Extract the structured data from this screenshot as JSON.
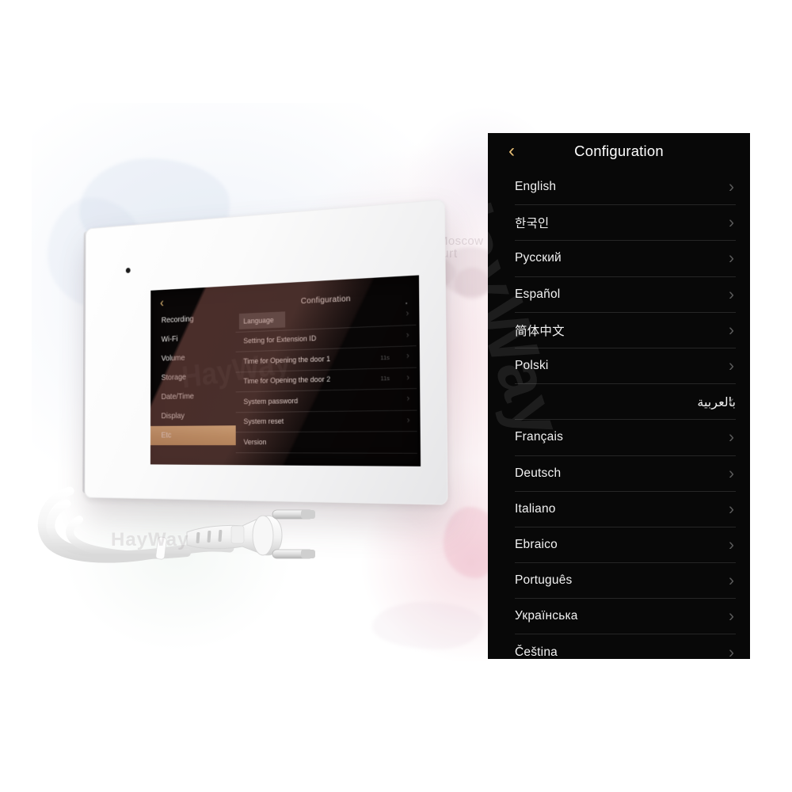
{
  "scene": {
    "background_color": "#ffffff",
    "watermark_text": "HayWay",
    "map_cities": [
      "Frankfurt",
      "Moscow"
    ]
  },
  "device": {
    "name": "video-intercom-monitor",
    "body_color": "#fbfbfb",
    "accent_color": "#c9a063",
    "screen": {
      "back_icon": "‹",
      "title": "Configuration",
      "sidebar": [
        {
          "label": "Recording",
          "selected": false
        },
        {
          "label": "Wi-Fi",
          "selected": false
        },
        {
          "label": "Volume",
          "selected": false
        },
        {
          "label": "Storage",
          "selected": false
        },
        {
          "label": "Date/Time",
          "selected": false
        },
        {
          "label": "Display",
          "selected": false
        },
        {
          "label": "Etc",
          "selected": true
        }
      ],
      "rows": [
        {
          "label": "Language",
          "value": "",
          "highlighted": true
        },
        {
          "label": "Setting for Extension ID",
          "value": "",
          "highlighted": false
        },
        {
          "label": "Time for Opening the door 1",
          "value": "11s",
          "highlighted": false
        },
        {
          "label": "Time for Opening the door 2",
          "value": "11s",
          "highlighted": false
        },
        {
          "label": "System  password",
          "value": "",
          "highlighted": false
        },
        {
          "label": "System reset",
          "value": "",
          "highlighted": false
        },
        {
          "label": "Version",
          "value": "",
          "highlighted": false
        }
      ],
      "chevron": "›"
    }
  },
  "language_panel": {
    "background_color": "#080808",
    "back_icon": "‹",
    "back_icon_color": "#e6bd74",
    "title": "Configuration",
    "chevron": "›",
    "items": [
      {
        "label": "English",
        "rtl": false,
        "cjk": false
      },
      {
        "label": "한국인",
        "rtl": false,
        "cjk": true
      },
      {
        "label": "Русский",
        "rtl": false,
        "cjk": false
      },
      {
        "label": "Español",
        "rtl": false,
        "cjk": false
      },
      {
        "label": "简体中文",
        "rtl": false,
        "cjk": true
      },
      {
        "label": "Polski",
        "rtl": false,
        "cjk": false
      },
      {
        "label": "بالعربية",
        "rtl": true,
        "cjk": false
      },
      {
        "label": "Français",
        "rtl": false,
        "cjk": false
      },
      {
        "label": "Deutsch",
        "rtl": false,
        "cjk": false
      },
      {
        "label": "Italiano",
        "rtl": false,
        "cjk": false
      },
      {
        "label": "Ebraico",
        "rtl": false,
        "cjk": false
      },
      {
        "label": "Português",
        "rtl": false,
        "cjk": false
      },
      {
        "label": "Українська",
        "rtl": false,
        "cjk": false
      },
      {
        "label": "Čeština",
        "rtl": false,
        "cjk": false
      }
    ]
  }
}
